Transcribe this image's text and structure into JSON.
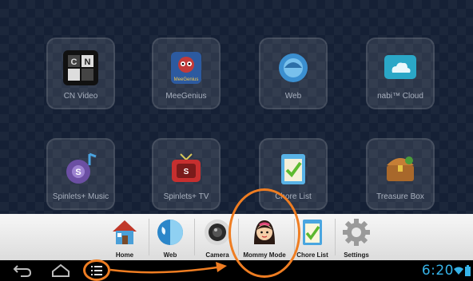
{
  "home_screen": {
    "apps": [
      {
        "label": "CN Video",
        "icon": "cn-video-icon"
      },
      {
        "label": "MeeGenius",
        "icon": "meegenius-icon",
        "art_text": "MeeGenius"
      },
      {
        "label": "Web",
        "icon": "web-icon"
      },
      {
        "label": "nabi™ Cloud",
        "icon": "nabi-cloud-icon"
      },
      {
        "label": "Spinlets+ Music",
        "icon": "spinlets-music-icon"
      },
      {
        "label": "Spinlets+ TV",
        "icon": "spinlets-tv-icon"
      },
      {
        "label": "Chore List",
        "icon": "chore-list-icon"
      },
      {
        "label": "Treasure Box",
        "icon": "treasure-box-icon"
      }
    ]
  },
  "dock": {
    "items": [
      {
        "label": "Home",
        "icon": "home-icon"
      },
      {
        "label": "Web",
        "icon": "globe-icon"
      },
      {
        "label": "Camera",
        "icon": "camera-icon"
      },
      {
        "label": "Mommy Mode",
        "icon": "mommy-mode-icon"
      },
      {
        "label": "Chore List",
        "icon": "chore-list-icon"
      },
      {
        "label": "Settings",
        "icon": "settings-gear-icon"
      }
    ]
  },
  "navbar": {
    "back": "back-arrow-icon",
    "home": "home-outline-icon",
    "menu": "menu-icon",
    "clock": "6:20",
    "wifi": "wifi-icon",
    "battery": "battery-icon"
  },
  "colors": {
    "accent_orange": "#ef7d22",
    "clock_blue": "#36b3e8",
    "background": "#1d2d4a"
  }
}
